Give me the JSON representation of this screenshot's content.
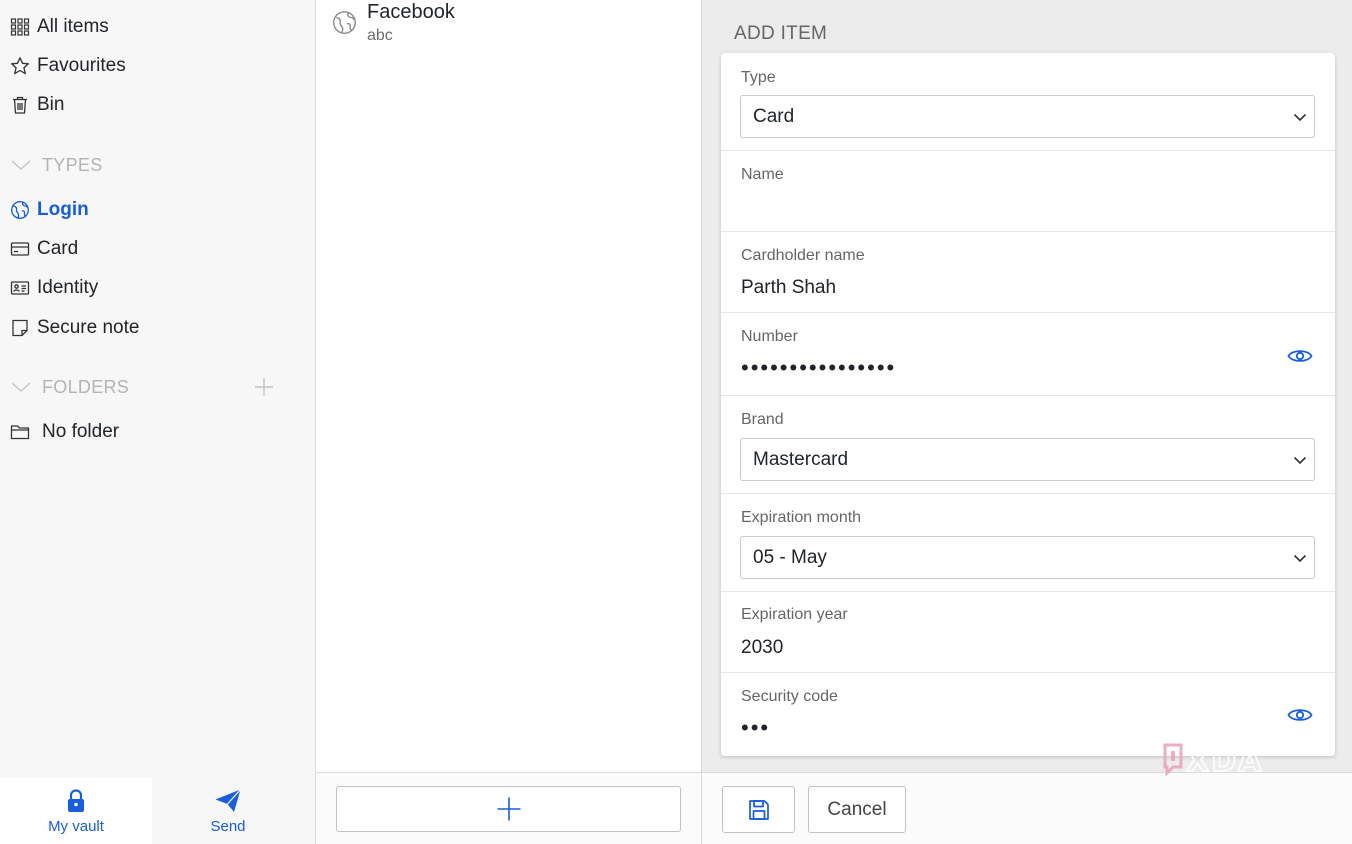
{
  "sidebar": {
    "all_items": "All items",
    "favourites": "Favourites",
    "bin": "Bin",
    "types_heading": "TYPES",
    "types": [
      "Login",
      "Card",
      "Identity",
      "Secure note"
    ],
    "folders_heading": "FOLDERS",
    "no_folder": "No folder",
    "active_item": "Login"
  },
  "bottom_tabs": {
    "my_vault": "My vault",
    "send": "Send"
  },
  "list": {
    "items": [
      {
        "title": "Facebook",
        "subtitle": "abc",
        "icon": "globe-icon"
      }
    ]
  },
  "detail": {
    "heading": "ADD ITEM",
    "type_label": "Type",
    "type_value": "Card",
    "name_label": "Name",
    "name_value": "",
    "cardholder_label": "Cardholder name",
    "cardholder_value": "Parth Shah",
    "number_label": "Number",
    "number_value": "••••••••••••••••",
    "brand_label": "Brand",
    "brand_value": "Mastercard",
    "exp_month_label": "Expiration month",
    "exp_month_value": "05 - May",
    "exp_year_label": "Expiration year",
    "exp_year_value": "2030",
    "security_label": "Security code",
    "security_value": "•••",
    "cancel_label": "Cancel"
  },
  "watermark": "XDA",
  "colors": {
    "accent": "#175ddc",
    "sidebar_bg": "#f7f7f7",
    "panel_bg": "#ececec",
    "muted_heading": "#b4b4b4"
  }
}
